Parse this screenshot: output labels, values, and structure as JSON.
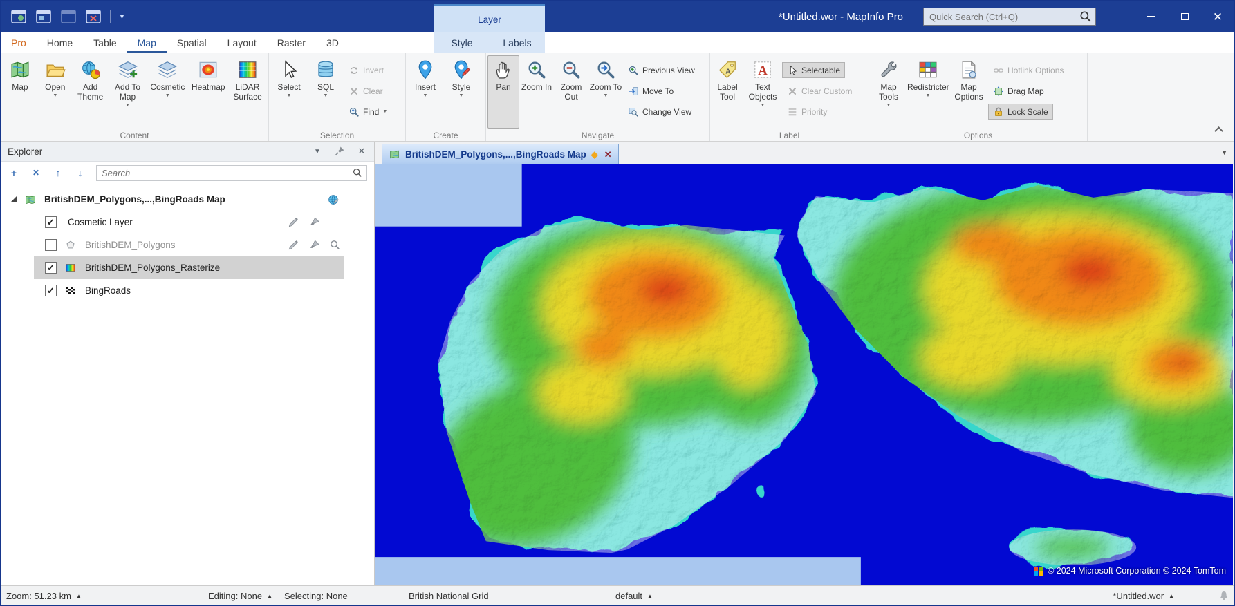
{
  "colors": {
    "titlebar": "#1c3e94",
    "accent": "#2a579a",
    "pro_tab_orange": "#d2691e",
    "ocean_blue": "#0209d2",
    "nodata_blue": "#a9c7ef",
    "selection_gray": "#d2d2d2"
  },
  "window": {
    "title": "*Untitled.wor - MapInfo Pro",
    "search_placeholder": "Quick Search (Ctrl+Q)"
  },
  "tabs": {
    "items": [
      "Pro",
      "Home",
      "Table",
      "Map",
      "Spatial",
      "Layout",
      "Raster",
      "3D"
    ],
    "active": "Map",
    "contextual_group": "Layer",
    "contextual": [
      "Style",
      "Labels"
    ]
  },
  "ribbon": {
    "content": {
      "label": "Content",
      "buttons": [
        "Map",
        "Open",
        "Add Theme",
        "Add To Map",
        "Cosmetic",
        "Heatmap",
        "LiDAR Surface"
      ]
    },
    "selection": {
      "label": "Selection",
      "large": [
        "Select",
        "SQL"
      ],
      "small": [
        "Invert",
        "Clear",
        "Find"
      ]
    },
    "create": {
      "label": "Create",
      "large": [
        "Insert",
        "Style"
      ]
    },
    "navigate": {
      "label": "Navigate",
      "large": [
        "Pan",
        "Zoom In",
        "Zoom Out",
        "Zoom To"
      ],
      "small": [
        "Previous View",
        "Move To",
        "Change View"
      ]
    },
    "label": {
      "label": "Label",
      "large": [
        "Label Tool",
        "Text Objects"
      ],
      "small": [
        "Selectable",
        "Clear Custom",
        "Priority"
      ]
    },
    "options": {
      "label": "Options",
      "large": [
        "Map Tools",
        "Redistricter",
        "Map Options"
      ],
      "small": [
        "Hotlink Options",
        "Drag Map",
        "Lock Scale"
      ]
    }
  },
  "explorer": {
    "title": "Explorer",
    "search_placeholder": "Search",
    "root": "BritishDEM_Polygons,...,BingRoads Map",
    "layers": [
      {
        "name": "Cosmetic Layer",
        "checked": true
      },
      {
        "name": "BritishDEM_Polygons",
        "checked": false
      },
      {
        "name": "BritishDEM_Polygons_Rasterize",
        "checked": true,
        "selected": true
      },
      {
        "name": "BingRoads",
        "checked": true
      }
    ]
  },
  "document": {
    "tab": "BritishDEM_Polygons,...,BingRoads Map",
    "attribution": "© 2024 Microsoft Corporation © 2024 TomTom"
  },
  "statusbar": {
    "zoom": "Zoom: 51.23 km",
    "editing": "Editing: None",
    "selecting": "Selecting: None",
    "projection": "British National Grid",
    "style": "default",
    "workspace": "*Untitled.wor"
  }
}
